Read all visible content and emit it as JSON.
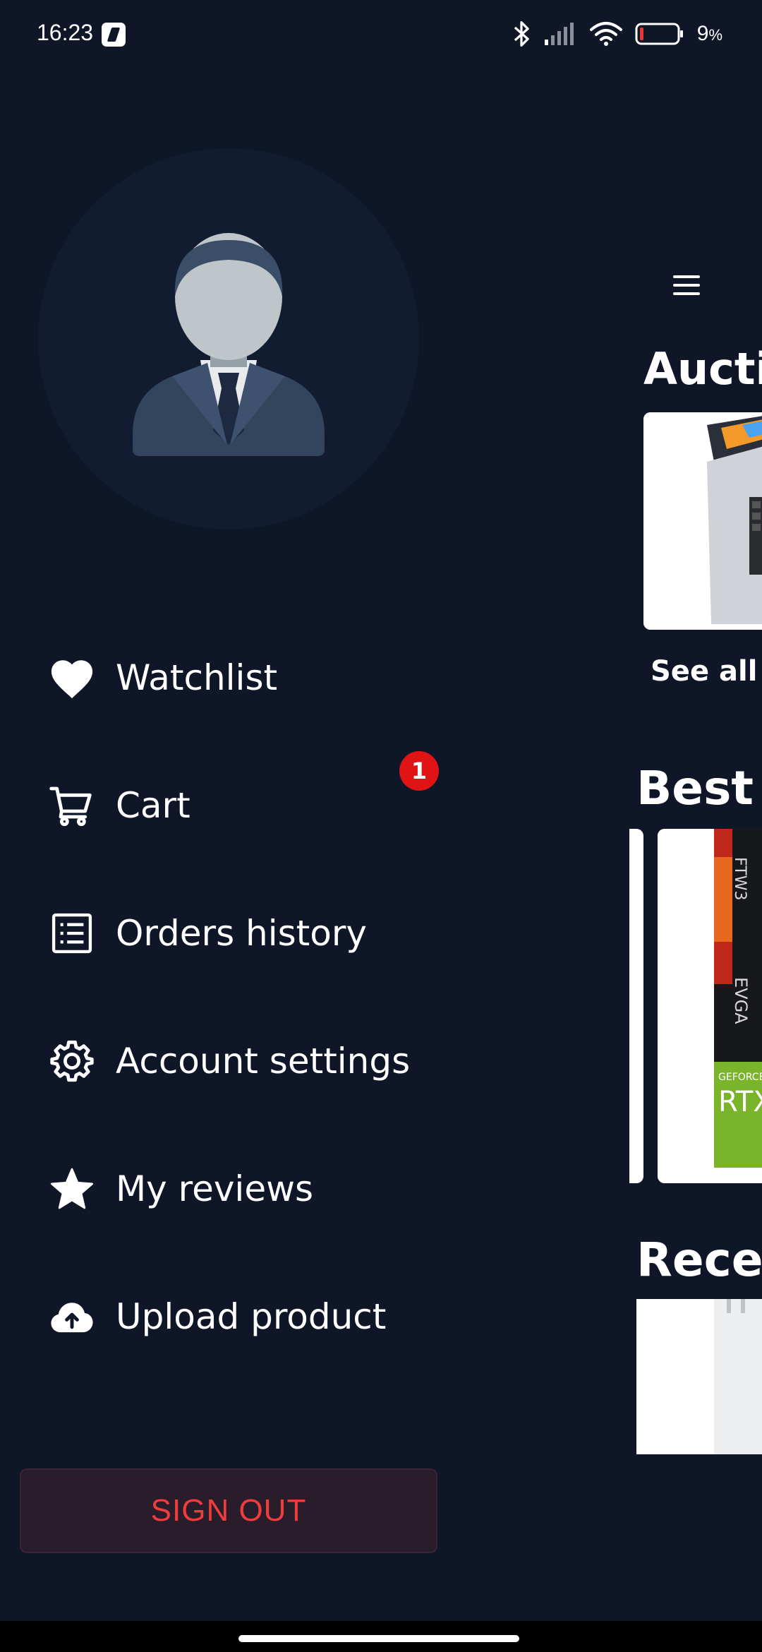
{
  "status_bar": {
    "time": "16:23",
    "battery_percent": "9",
    "battery_pct_symbol": "%",
    "icons": [
      "bluetooth-icon",
      "signal-icon",
      "wifi-icon",
      "battery-low-icon"
    ]
  },
  "drawer": {
    "avatar_icon": "user-avatar-icon",
    "menu": [
      {
        "label": "Watchlist",
        "icon": "heart-icon"
      },
      {
        "label": "Cart",
        "icon": "cart-icon"
      },
      {
        "label": "Orders history",
        "icon": "list-icon"
      },
      {
        "label": "Account settings",
        "icon": "gear-icon"
      },
      {
        "label": "My reviews",
        "icon": "star-icon"
      },
      {
        "label": "Upload product",
        "icon": "cloud-upload-icon"
      }
    ],
    "cart_badge": "1",
    "sign_out": "SIGN OUT"
  },
  "home": {
    "section_auctions": "Aucti",
    "see_all": "See all c",
    "section_best": "Best I",
    "section_recent": "Recen",
    "gpu_brand": "EVGA",
    "gpu_series": "FTW3",
    "gpu_model": "RTX",
    "gpu_line": "GEFORCE"
  },
  "colors": {
    "background": "#0e1628",
    "avatar_bg": "#121c30",
    "badge": "#e01414",
    "signout_text": "#ef3c3c",
    "signout_bg": "#2a1d2b"
  }
}
